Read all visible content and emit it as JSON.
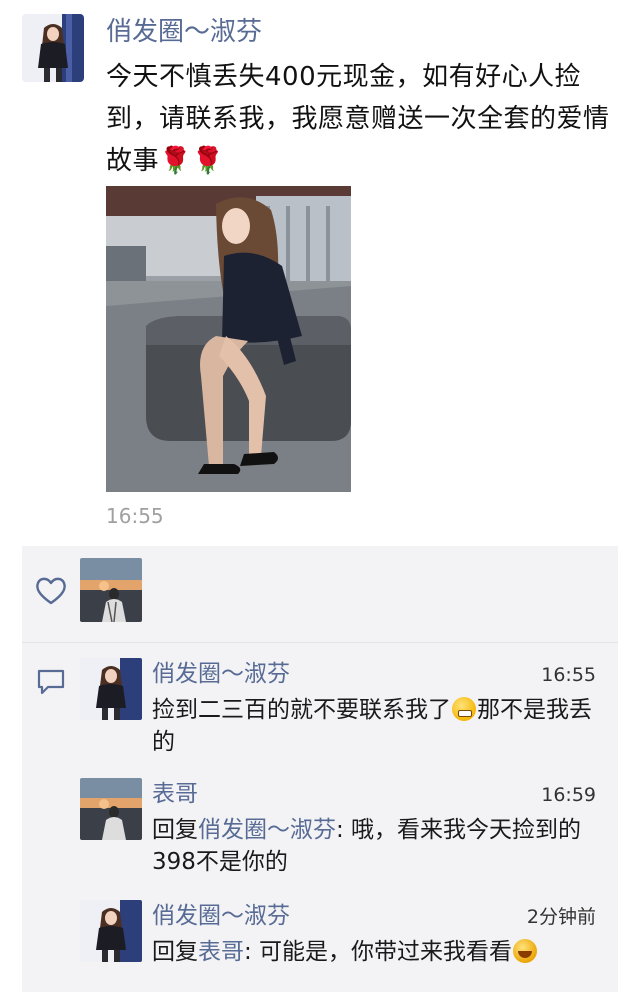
{
  "post": {
    "author": "俏发圈～淑芬",
    "text": "今天不慎丢失400元现金，如有好心人捡到，请联系我，我愿意赠送一次全套的爱情故事🌹🌹",
    "time": "16:55",
    "avatar_icon": "avatar-woman-icon",
    "photo_icon": "photo-woman-sitting"
  },
  "likes": {
    "icon": "heart-outline-icon",
    "liker_avatar_icon": "avatar-sunset-icon"
  },
  "comments_icon": "comment-bubble-icon",
  "comments": [
    {
      "name": "俏发圈～淑芬",
      "time": "16:55",
      "text_before": "捡到二三百的就不要联系我了",
      "text_after": "那不是我丢的",
      "emoji": "grimace-emoji",
      "avatar_icon": "avatar-woman-icon"
    },
    {
      "name": "表哥",
      "time": "16:59",
      "reply_label": "回复",
      "reply_target": "俏发圈～淑芬",
      "text": ": 哦，看来我今天捡到的398不是你的",
      "avatar_icon": "avatar-sunset-icon"
    },
    {
      "name": "俏发圈～淑芬",
      "time": "2分钟前",
      "reply_label": "回复",
      "reply_target": "表哥",
      "text": ": 可能是，你带过来我看看",
      "emoji": "laugh-emoji",
      "avatar_icon": "avatar-woman-icon"
    }
  ],
  "colors": {
    "name_blue": "#576b95",
    "comment_bg": "#f3f3f5",
    "time_gray": "#a0a0a0"
  }
}
